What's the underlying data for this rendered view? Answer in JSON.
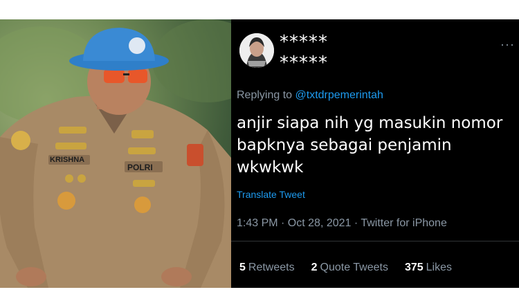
{
  "photo": {
    "nametag": "KRISHNA",
    "badge": "POLRI"
  },
  "tweet": {
    "display_name_line1": "*****",
    "display_name_line2": "*****",
    "replying_prefix": "Replying to",
    "replying_handle": "@txtdrpemerintah",
    "text": "anjir siapa nih yg masukin nomor bapknya sebagai penjamin wkwkwk",
    "translate_label": "Translate Tweet",
    "timestamp": "1:43 PM · Oct 28, 2021 · Twitter for iPhone",
    "stats": {
      "retweets_count": "5",
      "retweets_label": "Retweets",
      "quotes_count": "2",
      "quotes_label": "Quote Tweets",
      "likes_count": "375",
      "likes_label": "Likes"
    }
  },
  "colors": {
    "link": "#1d9bf0",
    "muted": "#8b98a5",
    "background": "#000000"
  }
}
